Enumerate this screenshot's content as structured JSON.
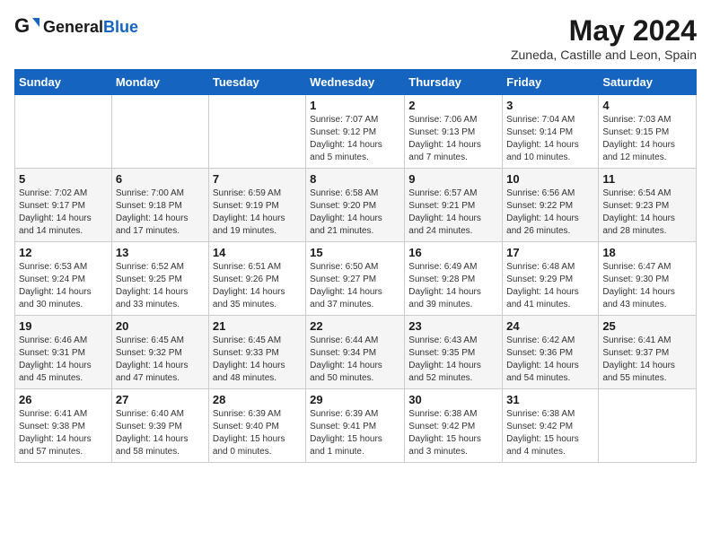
{
  "header": {
    "logo_general": "General",
    "logo_blue": "Blue",
    "month": "May 2024",
    "location": "Zuneda, Castille and Leon, Spain"
  },
  "weekdays": [
    "Sunday",
    "Monday",
    "Tuesday",
    "Wednesday",
    "Thursday",
    "Friday",
    "Saturday"
  ],
  "weeks": [
    [
      {
        "num": "",
        "info": ""
      },
      {
        "num": "",
        "info": ""
      },
      {
        "num": "",
        "info": ""
      },
      {
        "num": "1",
        "info": "Sunrise: 7:07 AM\nSunset: 9:12 PM\nDaylight: 14 hours\nand 5 minutes."
      },
      {
        "num": "2",
        "info": "Sunrise: 7:06 AM\nSunset: 9:13 PM\nDaylight: 14 hours\nand 7 minutes."
      },
      {
        "num": "3",
        "info": "Sunrise: 7:04 AM\nSunset: 9:14 PM\nDaylight: 14 hours\nand 10 minutes."
      },
      {
        "num": "4",
        "info": "Sunrise: 7:03 AM\nSunset: 9:15 PM\nDaylight: 14 hours\nand 12 minutes."
      }
    ],
    [
      {
        "num": "5",
        "info": "Sunrise: 7:02 AM\nSunset: 9:17 PM\nDaylight: 14 hours\nand 14 minutes."
      },
      {
        "num": "6",
        "info": "Sunrise: 7:00 AM\nSunset: 9:18 PM\nDaylight: 14 hours\nand 17 minutes."
      },
      {
        "num": "7",
        "info": "Sunrise: 6:59 AM\nSunset: 9:19 PM\nDaylight: 14 hours\nand 19 minutes."
      },
      {
        "num": "8",
        "info": "Sunrise: 6:58 AM\nSunset: 9:20 PM\nDaylight: 14 hours\nand 21 minutes."
      },
      {
        "num": "9",
        "info": "Sunrise: 6:57 AM\nSunset: 9:21 PM\nDaylight: 14 hours\nand 24 minutes."
      },
      {
        "num": "10",
        "info": "Sunrise: 6:56 AM\nSunset: 9:22 PM\nDaylight: 14 hours\nand 26 minutes."
      },
      {
        "num": "11",
        "info": "Sunrise: 6:54 AM\nSunset: 9:23 PM\nDaylight: 14 hours\nand 28 minutes."
      }
    ],
    [
      {
        "num": "12",
        "info": "Sunrise: 6:53 AM\nSunset: 9:24 PM\nDaylight: 14 hours\nand 30 minutes."
      },
      {
        "num": "13",
        "info": "Sunrise: 6:52 AM\nSunset: 9:25 PM\nDaylight: 14 hours\nand 33 minutes."
      },
      {
        "num": "14",
        "info": "Sunrise: 6:51 AM\nSunset: 9:26 PM\nDaylight: 14 hours\nand 35 minutes."
      },
      {
        "num": "15",
        "info": "Sunrise: 6:50 AM\nSunset: 9:27 PM\nDaylight: 14 hours\nand 37 minutes."
      },
      {
        "num": "16",
        "info": "Sunrise: 6:49 AM\nSunset: 9:28 PM\nDaylight: 14 hours\nand 39 minutes."
      },
      {
        "num": "17",
        "info": "Sunrise: 6:48 AM\nSunset: 9:29 PM\nDaylight: 14 hours\nand 41 minutes."
      },
      {
        "num": "18",
        "info": "Sunrise: 6:47 AM\nSunset: 9:30 PM\nDaylight: 14 hours\nand 43 minutes."
      }
    ],
    [
      {
        "num": "19",
        "info": "Sunrise: 6:46 AM\nSunset: 9:31 PM\nDaylight: 14 hours\nand 45 minutes."
      },
      {
        "num": "20",
        "info": "Sunrise: 6:45 AM\nSunset: 9:32 PM\nDaylight: 14 hours\nand 47 minutes."
      },
      {
        "num": "21",
        "info": "Sunrise: 6:45 AM\nSunset: 9:33 PM\nDaylight: 14 hours\nand 48 minutes."
      },
      {
        "num": "22",
        "info": "Sunrise: 6:44 AM\nSunset: 9:34 PM\nDaylight: 14 hours\nand 50 minutes."
      },
      {
        "num": "23",
        "info": "Sunrise: 6:43 AM\nSunset: 9:35 PM\nDaylight: 14 hours\nand 52 minutes."
      },
      {
        "num": "24",
        "info": "Sunrise: 6:42 AM\nSunset: 9:36 PM\nDaylight: 14 hours\nand 54 minutes."
      },
      {
        "num": "25",
        "info": "Sunrise: 6:41 AM\nSunset: 9:37 PM\nDaylight: 14 hours\nand 55 minutes."
      }
    ],
    [
      {
        "num": "26",
        "info": "Sunrise: 6:41 AM\nSunset: 9:38 PM\nDaylight: 14 hours\nand 57 minutes."
      },
      {
        "num": "27",
        "info": "Sunrise: 6:40 AM\nSunset: 9:39 PM\nDaylight: 14 hours\nand 58 minutes."
      },
      {
        "num": "28",
        "info": "Sunrise: 6:39 AM\nSunset: 9:40 PM\nDaylight: 15 hours\nand 0 minutes."
      },
      {
        "num": "29",
        "info": "Sunrise: 6:39 AM\nSunset: 9:41 PM\nDaylight: 15 hours\nand 1 minute."
      },
      {
        "num": "30",
        "info": "Sunrise: 6:38 AM\nSunset: 9:42 PM\nDaylight: 15 hours\nand 3 minutes."
      },
      {
        "num": "31",
        "info": "Sunrise: 6:38 AM\nSunset: 9:42 PM\nDaylight: 15 hours\nand 4 minutes."
      },
      {
        "num": "",
        "info": ""
      }
    ]
  ]
}
